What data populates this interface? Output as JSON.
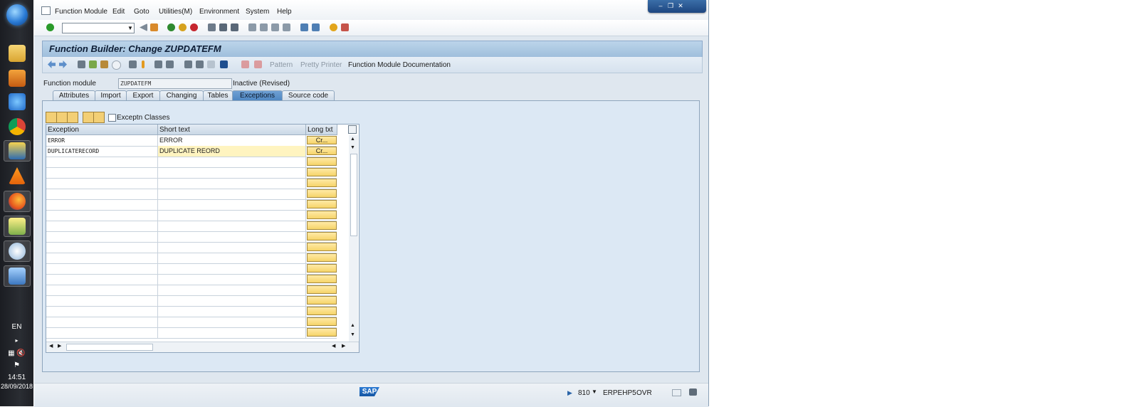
{
  "taskbar": {
    "language": "EN",
    "time": "14:51",
    "date": "28/09/2018"
  },
  "menubar": {
    "items": [
      "Function Module",
      "Edit",
      "Goto",
      "Utilities(M)",
      "Environment",
      "System",
      "Help"
    ]
  },
  "window": {
    "title": "Function Builder: Change ZUPDATEFM"
  },
  "app_toolbar": {
    "pattern": "Pattern",
    "pretty_printer": "Pretty Printer",
    "fm_documentation": "Function Module Documentation"
  },
  "function_module": {
    "label": "Function module",
    "value": "ZUPDATEFM",
    "status": "Inactive (Revised)"
  },
  "tabs": [
    "Attributes",
    "Import",
    "Export",
    "Changing",
    "Tables",
    "Exceptions",
    "Source code"
  ],
  "active_tab": "Exceptions",
  "exceptions_grid": {
    "checkbox_label": "Exceptn Classes",
    "columns": [
      "Exception",
      "Short text",
      "Long txt"
    ],
    "rows": [
      {
        "exception": "ERROR",
        "short_text": "ERROR",
        "long_txt": "Cr..."
      },
      {
        "exception": "DUPLICATERECORD",
        "short_text": "DUPLICATE REORD",
        "long_txt": "Cr..."
      }
    ]
  },
  "statusbar": {
    "logo": "SAP",
    "client": "810",
    "system": "ERPEHP5",
    "mode": "OVR"
  },
  "colors": {
    "title_bg": "#9fbfdc",
    "active_tab": "#4d85c1",
    "highlight_row": "#fff4c0",
    "button_yellow": "#f6d46a"
  }
}
